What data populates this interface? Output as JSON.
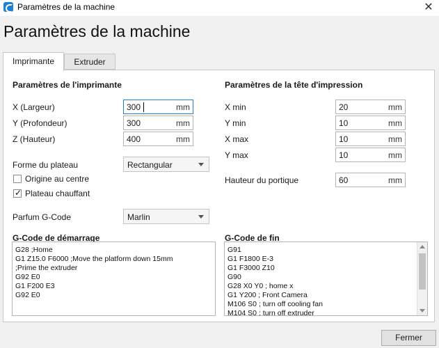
{
  "window": {
    "title": "Paramètres de la machine",
    "close_symbol": "✕"
  },
  "heading": "Paramètres de la machine",
  "tabs": [
    {
      "label": "Imprimante"
    },
    {
      "label": "Extruder"
    }
  ],
  "printer": {
    "section_title": "Paramètres de l'imprimante",
    "fields": [
      {
        "label": "X (Largeur)",
        "value": "300",
        "unit": "mm"
      },
      {
        "label": "Y (Profondeur)",
        "value": "300",
        "unit": "mm"
      },
      {
        "label": "Z (Hauteur)",
        "value": "400",
        "unit": "mm"
      }
    ],
    "bed_shape": {
      "label": "Forme du plateau",
      "value": "Rectangular"
    },
    "origin_center": {
      "label": "Origine au centre",
      "checked": false
    },
    "heated_bed": {
      "label": "Plateau chauffant",
      "checked": true,
      "mark": "✓"
    },
    "gcode_flavor": {
      "label": "Parfum G-Code",
      "value": "Marlin"
    }
  },
  "printhead": {
    "section_title": "Paramètres de la tête d'impression",
    "fields": [
      {
        "label": "X min",
        "value": "20",
        "unit": "mm"
      },
      {
        "label": "Y min",
        "value": "10",
        "unit": "mm"
      },
      {
        "label": "X max",
        "value": "10",
        "unit": "mm"
      },
      {
        "label": "Y max",
        "value": "10",
        "unit": "mm"
      }
    ],
    "gantry": {
      "label": "Hauteur du portique",
      "value": "60",
      "unit": "mm"
    }
  },
  "start_gcode": {
    "title": "G-Code de démarrage",
    "lines": [
      "G28 ;Home",
      "G1 Z15.0 F6000 ;Move the platform down 15mm",
      ";Prime the extruder",
      "G92 E0",
      "G1 F200 E3",
      "G92 E0"
    ]
  },
  "end_gcode": {
    "title": "G-Code de fin",
    "lines": [
      "G91",
      "G1 F1800 E-3",
      "G1 F3000 Z10",
      "G90",
      "G28 X0 Y0 ; home x",
      "G1 Y200 ; Front Camera",
      "M106 S0 ; turn off cooling fan",
      "M104 S0 ; turn off extruder"
    ]
  },
  "footer": {
    "close_label": "Fermer"
  }
}
